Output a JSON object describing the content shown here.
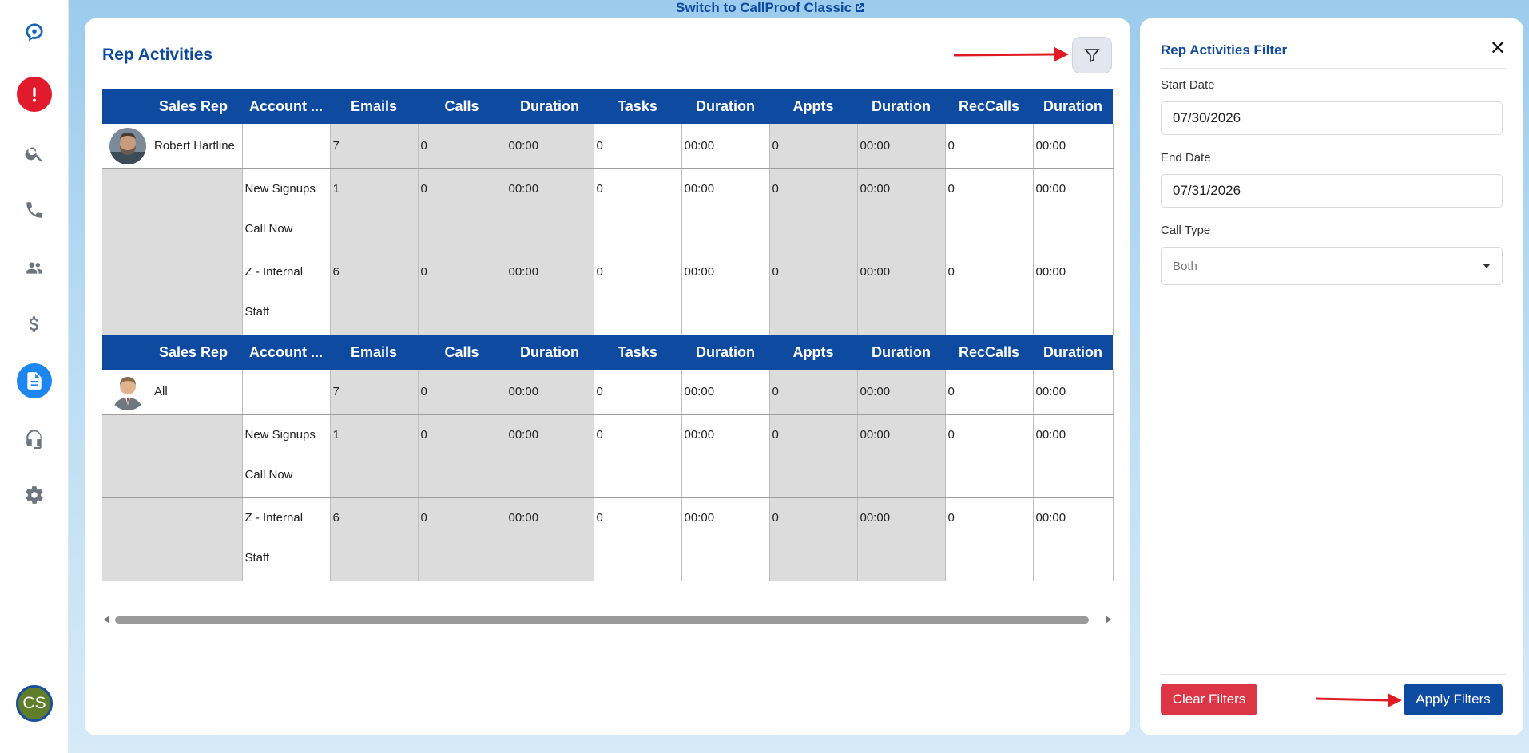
{
  "top_link": {
    "label": "Switch to CallProof Classic"
  },
  "sidebar": {
    "items": [
      {
        "name": "logo",
        "icon": "callproof-logo-icon"
      },
      {
        "name": "alerts",
        "icon": "exclamation-icon"
      },
      {
        "name": "search",
        "icon": "search-icon"
      },
      {
        "name": "calls",
        "icon": "phone-icon"
      },
      {
        "name": "contacts",
        "icon": "people-icon"
      },
      {
        "name": "sales",
        "icon": "dollar-icon"
      },
      {
        "name": "reports",
        "icon": "document-icon",
        "active": true
      },
      {
        "name": "support",
        "icon": "headset-icon"
      },
      {
        "name": "settings",
        "icon": "gear-icon"
      }
    ],
    "user_initials": "CS"
  },
  "main": {
    "title": "Rep Activities",
    "columns": [
      "Sales Rep",
      "Account ...",
      "Emails",
      "Calls",
      "Duration",
      "Tasks",
      "Duration",
      "Appts",
      "Duration",
      "RecCalls",
      "Duration"
    ],
    "groups": [
      {
        "rep": "Robert Hartline",
        "avatar": "rep-photo",
        "summary": [
          "",
          "7",
          "0",
          "00:00",
          "0",
          "00:00",
          "0",
          "00:00",
          "0",
          "00:00"
        ],
        "rows": [
          {
            "account": "New Signups Call Now",
            "values": [
              "1",
              "0",
              "00:00",
              "0",
              "00:00",
              "0",
              "00:00",
              "0",
              "00:00"
            ]
          },
          {
            "account": "Z - Internal Staff",
            "values": [
              "6",
              "0",
              "00:00",
              "0",
              "00:00",
              "0",
              "00:00",
              "0",
              "00:00"
            ]
          }
        ]
      },
      {
        "rep": "All",
        "avatar": "generic-user",
        "summary": [
          "",
          "7",
          "0",
          "00:00",
          "0",
          "00:00",
          "0",
          "00:00",
          "0",
          "00:00"
        ],
        "rows": [
          {
            "account": "New Signups Call Now",
            "values": [
              "1",
              "0",
              "00:00",
              "0",
              "00:00",
              "0",
              "00:00",
              "0",
              "00:00"
            ]
          },
          {
            "account": "Z - Internal Staff",
            "values": [
              "6",
              "0",
              "00:00",
              "0",
              "00:00",
              "0",
              "00:00",
              "0",
              "00:00"
            ]
          }
        ]
      }
    ]
  },
  "filter_panel": {
    "title": "Rep Activities Filter",
    "start_date_label": "Start Date",
    "start_date_value": "07/30/2026",
    "end_date_label": "End Date",
    "end_date_value": "07/31/2026",
    "call_type_label": "Call Type",
    "call_type_value": "Both",
    "clear_label": "Clear Filters",
    "apply_label": "Apply Filters"
  },
  "colors": {
    "brand": "#0d4aa0",
    "danger": "#dc3545",
    "active_icon": "#1e86f0",
    "alert_icon": "#e21b2c",
    "annotation_arrow": "#e01b24"
  }
}
